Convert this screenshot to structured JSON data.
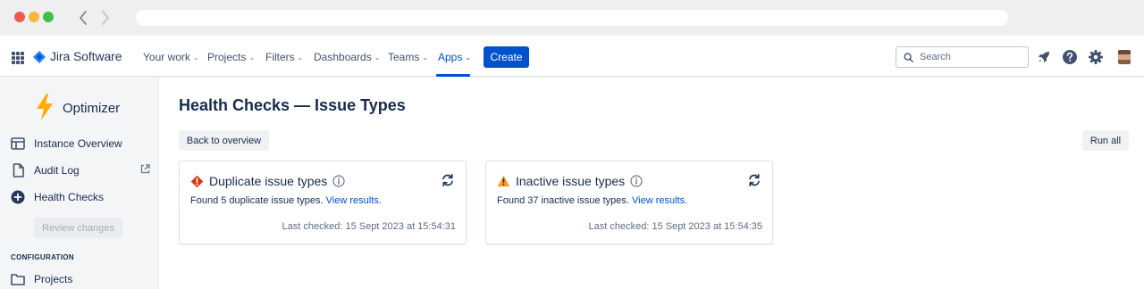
{
  "topnav": {
    "product_name": "Jira Software",
    "menu": [
      {
        "label": "Your work"
      },
      {
        "label": "Projects"
      },
      {
        "label": "Filters"
      },
      {
        "label": "Dashboards"
      },
      {
        "label": "Teams"
      },
      {
        "label": "Apps"
      }
    ],
    "active_menu": "Apps",
    "create_label": "Create",
    "search_placeholder": "Search",
    "icons": [
      "app-switcher-icon",
      "rocket-icon",
      "help-icon",
      "settings-icon",
      "avatar"
    ]
  },
  "sidebar": {
    "app_name": "Optimizer",
    "items": [
      {
        "label": "Instance Overview",
        "icon": "table-layout-icon"
      },
      {
        "label": "Audit Log",
        "icon": "document-icon"
      },
      {
        "label": "Health Checks",
        "icon": "add-circle-icon"
      }
    ],
    "review_label": "Review changes",
    "config_heading": "CONFIGURATION",
    "config_items": [
      {
        "label": "Projects",
        "icon": "folder-icon"
      }
    ]
  },
  "main": {
    "title": "Health Checks — Issue Types",
    "back_label": "Back to overview",
    "run_all_label": "Run all",
    "cards": [
      {
        "title": "Duplicate issue types",
        "status": "error",
        "desc_prefix": "Found 5 duplicate issue types. ",
        "link": "View results",
        "desc_suffix": ".",
        "last_checked": "Last checked: 15 Sept 2023 at 15:54:31"
      },
      {
        "title": "Inactive issue types",
        "status": "warning",
        "desc_prefix": "Found 37 inactive issue types. ",
        "link": "View results",
        "desc_suffix": ".",
        "last_checked": "Last checked: 15 Sept 2023 at 15:54:35"
      }
    ]
  },
  "colors": {
    "brand": "#0052CC",
    "error": "#DE350B",
    "warning": "#FF991F",
    "bolt": "#FFAB00"
  }
}
